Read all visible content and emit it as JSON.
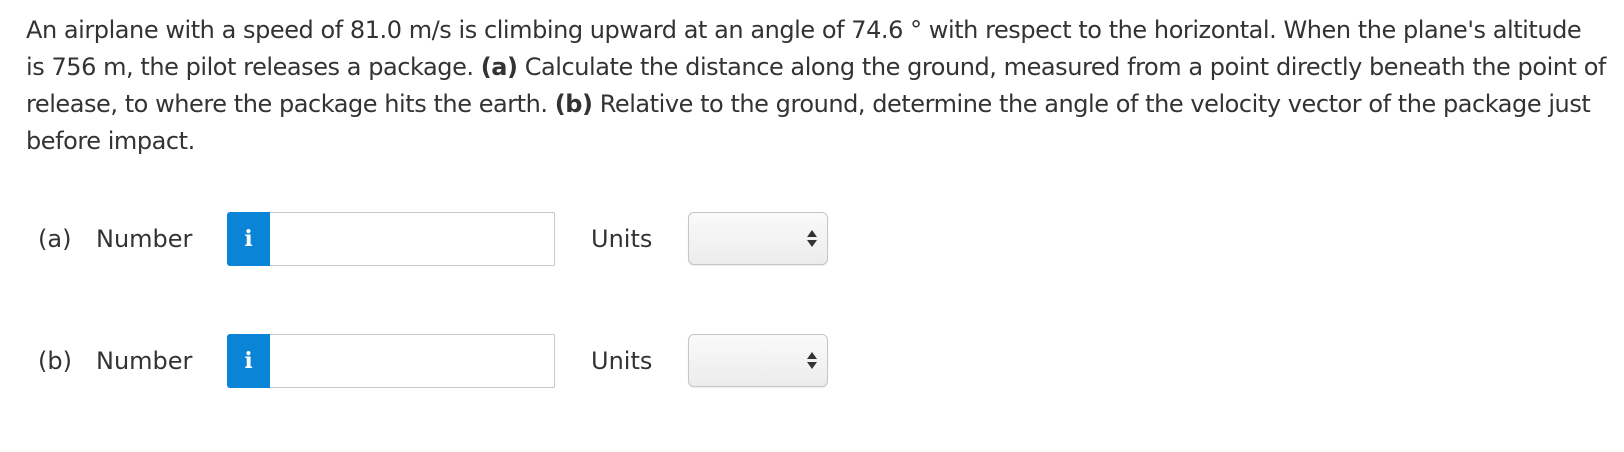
{
  "question": {
    "text_1": "An airplane with a speed of 81.0 m/s is climbing upward at an angle of 74.6 ° with respect to the horizontal. When the plane's altitude is 756 m, the pilot releases a package. ",
    "part_a_marker": "(a)",
    "text_2": " Calculate the distance along the ground, measured from a point directly beneath the point of release, to where the package hits the earth. ",
    "part_b_marker": "(b)",
    "text_3": " Relative to the ground, determine the angle of the velocity vector of the package just before impact."
  },
  "answers": [
    {
      "part_label": "(a)",
      "number_label": "Number",
      "info_icon_glyph": "i",
      "number_value": "",
      "units_label": "Units",
      "units_selected": ""
    },
    {
      "part_label": "(b)",
      "number_label": "Number",
      "info_icon_glyph": "i",
      "number_value": "",
      "units_label": "Units",
      "units_selected": ""
    }
  ],
  "colors": {
    "info_button": "#0a84d6",
    "text": "#333333"
  }
}
